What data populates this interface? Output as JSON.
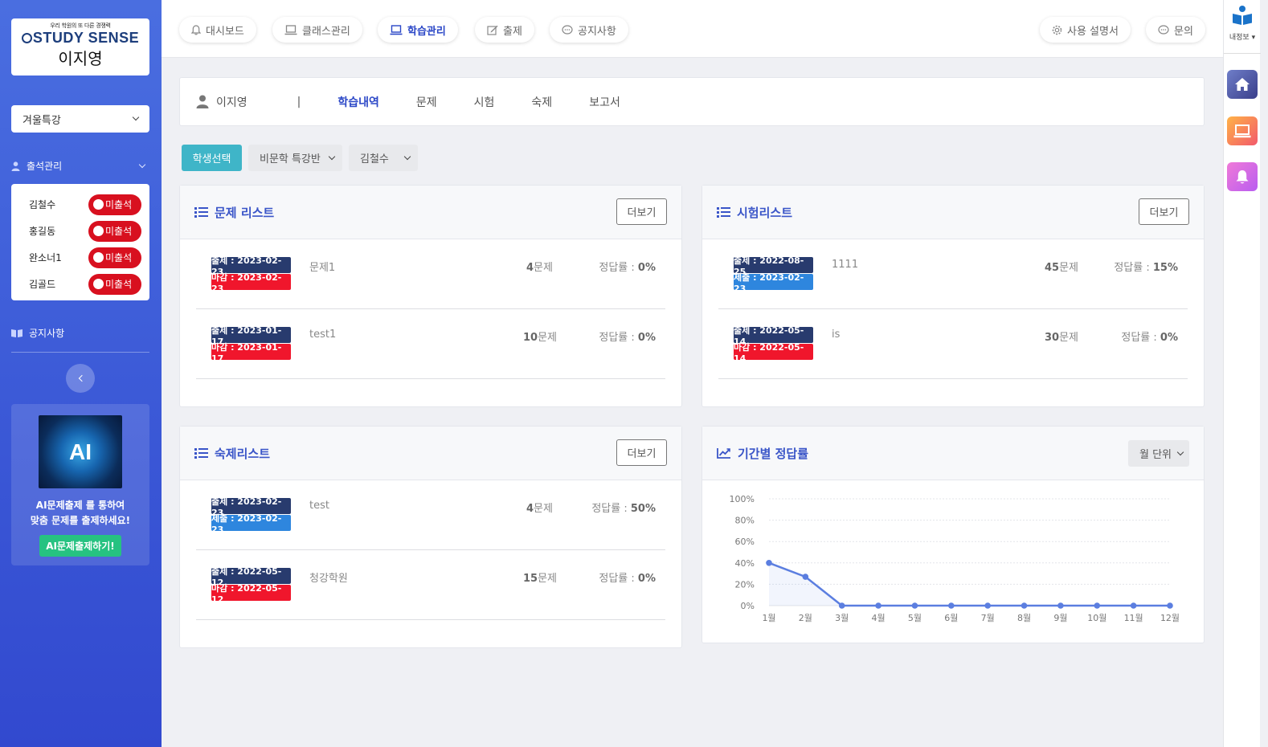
{
  "sidebar": {
    "logo_tagline": "우리 학원의 또 다른 경쟁력",
    "logo_brand": "STUDY SENSE",
    "user_name": "이지영",
    "class_selected": "겨울특강",
    "attendance_title": "출석관리",
    "attendance": [
      {
        "name": "김철수",
        "status": "미출석"
      },
      {
        "name": "홍길동",
        "status": "미출석"
      },
      {
        "name": "완소너1",
        "status": "미출석"
      },
      {
        "name": "김골드",
        "status": "미출석"
      }
    ],
    "notice_title": "공지사항",
    "ai_label": "AI",
    "ai_text_line1": "AI문제출제 를 통하여",
    "ai_text_line2": "맞춤 문제를 출제하세요!",
    "ai_button": "AI문제출제하기!"
  },
  "topnav": {
    "items": [
      "대시보드",
      "클래스관리",
      "학습관리",
      "출제",
      "공지사항"
    ],
    "active": "학습관리",
    "manual": "사용 설명서",
    "inquiry": "문의"
  },
  "rail": {
    "my_info": "내정보"
  },
  "student_bar": {
    "name": "이지영",
    "separator": "|",
    "tabs": [
      "학습내역",
      "문제",
      "시험",
      "숙제",
      "보고서"
    ]
  },
  "filters": {
    "select_button": "학생선택",
    "class": "비문학 특강반",
    "student": "김철수"
  },
  "problem_list": {
    "title": "문제 리스트",
    "more": "더보기",
    "items": [
      {
        "issued": "출제 : 2023-02-23",
        "deadline": "마감 : 2023-02-23",
        "title": "문제1",
        "count": "4",
        "count_unit": "문제",
        "rate_label": "정답률 :",
        "rate": "0%"
      },
      {
        "issued": "출제 : 2023-01-17",
        "deadline": "마감 : 2023-01-17",
        "title": "test1",
        "count": "10",
        "count_unit": "문제",
        "rate_label": "정답률 :",
        "rate": "0%"
      }
    ]
  },
  "exam_list": {
    "title": "시험리스트",
    "more": "더보기",
    "items": [
      {
        "issued": "출제 : 2022-08-25",
        "deadline": "제출 : 2023-02-23",
        "deadline_kind": "submit",
        "title": "1111",
        "count": "45",
        "count_unit": "문제",
        "rate_label": "정답률 :",
        "rate": "15%"
      },
      {
        "issued": "출제 : 2022-05-14",
        "deadline": "마감 : 2022-05-14",
        "deadline_kind": "deadline",
        "title": "is",
        "count": "30",
        "count_unit": "문제",
        "rate_label": "정답률 :",
        "rate": "0%"
      }
    ]
  },
  "homework_list": {
    "title": "숙제리스트",
    "more": "더보기",
    "items": [
      {
        "issued": "출제 : 2023-02-23",
        "deadline": "제출 : 2023-02-23",
        "deadline_kind": "submit",
        "title": "test",
        "count": "4",
        "count_unit": "문제",
        "rate_label": "정답률 :",
        "rate": "50%"
      },
      {
        "issued": "출제 : 2022-05-12",
        "deadline": "마감 : 2022-05-12",
        "deadline_kind": "deadline",
        "title": "청강학원",
        "count": "15",
        "count_unit": "문제",
        "rate_label": "정답률 :",
        "rate": "0%"
      }
    ]
  },
  "period_chart": {
    "title": "기간별 정답률",
    "unit_select": "월 단위"
  },
  "colors": {
    "accent": "#2b47c7",
    "issued_badge": "#283b6e",
    "deadline_badge": "#f0162c",
    "submit_badge": "#2e86de",
    "line": "#5b7ee0"
  },
  "chart_data": {
    "type": "line",
    "categories": [
      "1월",
      "2월",
      "3월",
      "4월",
      "5월",
      "6월",
      "7월",
      "8월",
      "9월",
      "10월",
      "11월",
      "12월"
    ],
    "values": [
      40,
      27,
      0,
      0,
      0,
      0,
      0,
      0,
      0,
      0,
      0,
      0
    ],
    "yticks": [
      "0%",
      "20%",
      "40%",
      "60%",
      "80%",
      "100%"
    ],
    "ylim": [
      0,
      100
    ],
    "grid": true
  }
}
